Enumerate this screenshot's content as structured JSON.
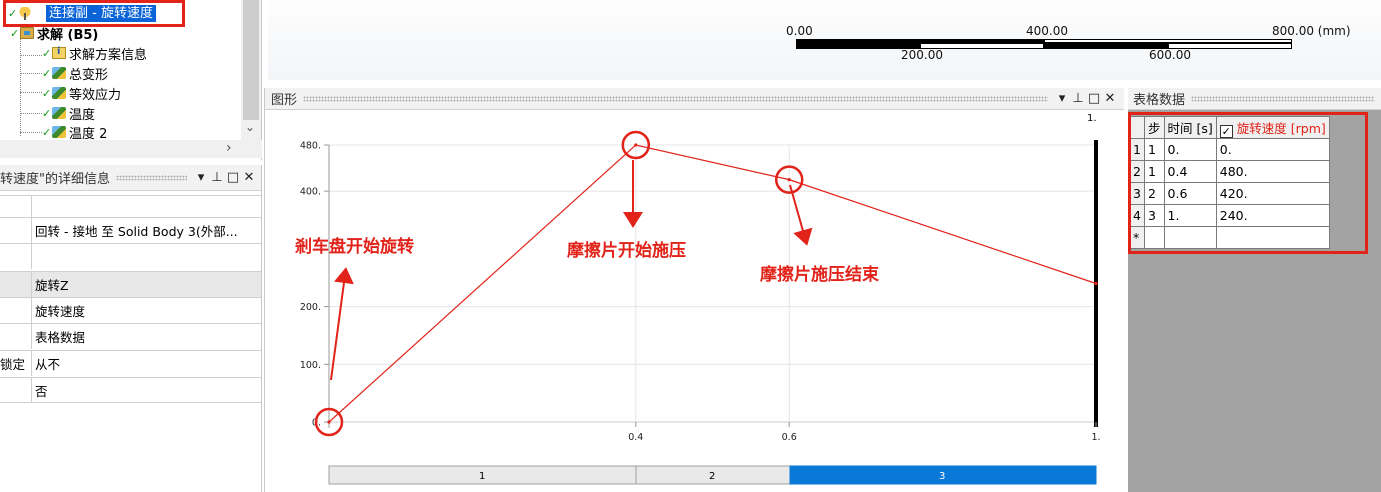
{
  "tree": {
    "selected_label": "连接副 - 旋转速度",
    "solution_label": "求解 (B5)",
    "items": [
      {
        "label": "求解方案信息",
        "icon": "solution-info-icon"
      },
      {
        "label": "总变形",
        "icon": "result-cube-icon"
      },
      {
        "label": "等效应力",
        "icon": "result-cube-icon"
      },
      {
        "label": "温度",
        "icon": "result-cube-icon"
      },
      {
        "label": "温度 2",
        "icon": "result-cube-icon"
      }
    ]
  },
  "details": {
    "title": "转速度\"的详细信息",
    "rows": [
      {
        "key": "",
        "value": ""
      },
      {
        "key": "",
        "value": "回转 - 接地 至 Solid Body 3(外部..."
      },
      {
        "key": "",
        "value": ""
      },
      {
        "key": "",
        "value": "旋转Z"
      },
      {
        "key": "",
        "value": "旋转速度"
      },
      {
        "key": "",
        "value": "表格数据"
      },
      {
        "key": "锁定",
        "value": "从不"
      },
      {
        "key": "",
        "value": "否"
      }
    ]
  },
  "scale": {
    "top_labels": [
      "0.00",
      "400.00",
      "800.00 (mm)"
    ],
    "bottom_labels": [
      "200.00",
      "600.00"
    ]
  },
  "graph": {
    "title": "图形",
    "annotations": {
      "a1": "剎车盘开始旋转",
      "a2": "摩擦片开始施压",
      "a3": "摩擦片施压结束"
    },
    "steps": [
      "1",
      "2",
      "3"
    ],
    "top_right_label": "1."
  },
  "chart_data": {
    "type": "line",
    "x": [
      0,
      0.4,
      0.6,
      1.0
    ],
    "series": [
      {
        "values": [
          0,
          480,
          420,
          240
        ]
      }
    ],
    "x_ticks": [
      "0.4",
      "0.6",
      "1."
    ],
    "y_ticks": [
      "0.",
      "100.",
      "200.",
      "400.",
      "480."
    ],
    "xlim": [
      0,
      1
    ],
    "ylim": [
      0,
      480
    ],
    "color": "#e2231a"
  },
  "table": {
    "title": "表格数据",
    "headers": [
      "步",
      "时间 [s]",
      "旋转速度 [rpm]"
    ],
    "rows": [
      {
        "n": "1",
        "step": "1",
        "time": "0.",
        "speed": "0."
      },
      {
        "n": "2",
        "step": "1",
        "time": "0.4",
        "speed": "480."
      },
      {
        "n": "3",
        "step": "2",
        "time": "0.6",
        "speed": "420."
      },
      {
        "n": "4",
        "step": "3",
        "time": "1.",
        "speed": "240."
      }
    ],
    "new_row_marker": "*"
  },
  "colors": {
    "highlight_red": "#e2231a",
    "selection_blue": "#0a64d8",
    "step_active": "#0a78d7"
  }
}
